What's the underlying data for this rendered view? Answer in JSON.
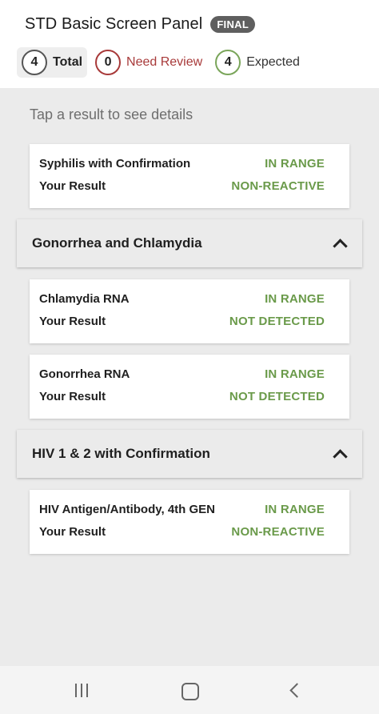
{
  "header": {
    "title": "STD Basic Screen Panel",
    "badge": "FINAL"
  },
  "summary": {
    "total": {
      "count": "4",
      "label": "Total"
    },
    "review": {
      "count": "0",
      "label": "Need Review"
    },
    "expected": {
      "count": "4",
      "label": "Expected"
    }
  },
  "hint": "Tap a result to see details",
  "cards": {
    "syphilis": {
      "name": "Syphilis with Confirmation",
      "status": "IN RANGE",
      "result_label": "Your Result",
      "result": "NON-REACTIVE"
    },
    "chlamydia": {
      "name": "Chlamydia RNA",
      "status": "IN RANGE",
      "result_label": "Your Result",
      "result": "NOT DETECTED"
    },
    "gonorrhea": {
      "name": "Gonorrhea RNA",
      "status": "IN RANGE",
      "result_label": "Your Result",
      "result": "NOT DETECTED"
    },
    "hiv": {
      "name": "HIV Antigen/Antibody, 4th GEN",
      "status": "IN RANGE",
      "result_label": "Your Result",
      "result": "NON-REACTIVE"
    }
  },
  "groups": {
    "gc": {
      "title": "Gonorrhea and Chlamydia"
    },
    "hiv": {
      "title": "HIV 1 & 2 with Confirmation"
    }
  },
  "colors": {
    "in_range": "#6a9a4a",
    "need_review": "#a83a3a",
    "badge_bg": "#5f5f5f"
  },
  "icons": {
    "group_toggle": "chevron-up-icon",
    "nav": [
      "recents-icon",
      "home-icon",
      "back-icon"
    ]
  }
}
